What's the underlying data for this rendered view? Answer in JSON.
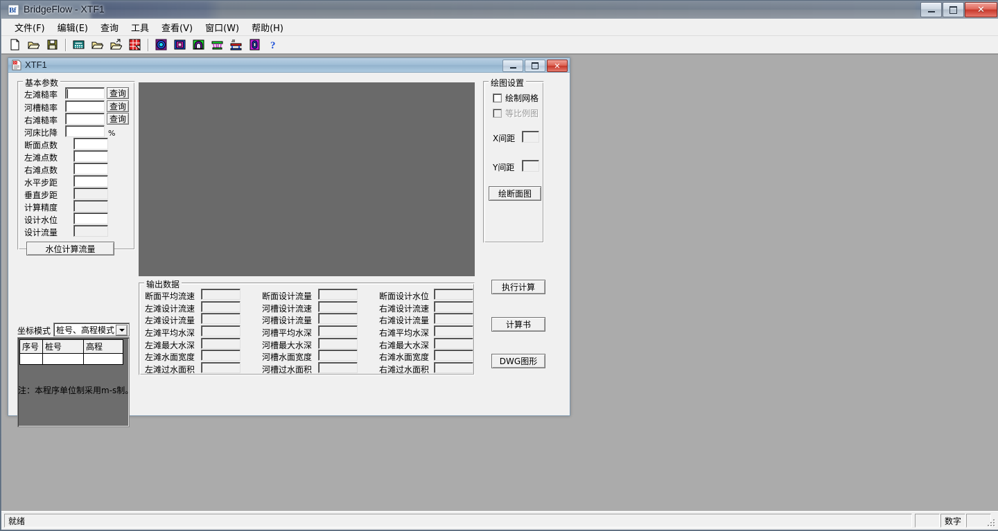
{
  "window": {
    "title": "BridgeFlow - XTF1",
    "icon": "app-icon",
    "minimize": "–",
    "maximize": "□",
    "close": "✕"
  },
  "menu": {
    "items": [
      {
        "label": "文件(F)",
        "name": "menu-file"
      },
      {
        "label": "编辑(E)",
        "name": "menu-edit"
      },
      {
        "label": "查询",
        "name": "menu-query"
      },
      {
        "label": "工具",
        "name": "menu-tools"
      },
      {
        "label": "查看(V)",
        "name": "menu-view"
      },
      {
        "label": "窗口(W)",
        "name": "menu-window"
      },
      {
        "label": "帮助(H)",
        "name": "menu-help"
      }
    ]
  },
  "toolbar": {
    "buttons": [
      {
        "name": "new-icon",
        "title": "新建"
      },
      {
        "name": "open-icon",
        "title": "打开"
      },
      {
        "name": "save-icon",
        "title": "保存"
      },
      {
        "name": "calculator-icon",
        "title": "计算"
      },
      {
        "name": "open-folder-icon",
        "title": "打开文件"
      },
      {
        "name": "open-folder-arrow-icon",
        "title": "导入"
      },
      {
        "name": "grid-red-icon",
        "title": "表格"
      },
      {
        "name": "circle-section-icon",
        "title": "圆形断面"
      },
      {
        "name": "square-section-icon",
        "title": "方形断面"
      },
      {
        "name": "arch-section-icon",
        "title": "拱形断面"
      },
      {
        "name": "pier-icon",
        "title": "桥墩"
      },
      {
        "name": "bridge-icon",
        "title": "桥梁"
      },
      {
        "name": "capsule-icon",
        "title": "构件"
      },
      {
        "name": "help-icon",
        "title": "帮助"
      }
    ]
  },
  "child_window": {
    "title": "XTF1",
    "icon": "document-icon",
    "minimize": "–",
    "maximize": "□",
    "close": "✕"
  },
  "basic_params": {
    "legend": "基本参数",
    "rows": [
      {
        "label": "左滩糙率",
        "value": "",
        "enabled": true,
        "focused": true,
        "query": "查询",
        "unit": ""
      },
      {
        "label": "河槽糙率",
        "value": "",
        "enabled": true,
        "focused": false,
        "query": "查询",
        "unit": ""
      },
      {
        "label": "右滩糙率",
        "value": "",
        "enabled": true,
        "focused": false,
        "query": "查询",
        "unit": ""
      },
      {
        "label": "河床比降",
        "value": "",
        "enabled": true,
        "focused": false,
        "query": "",
        "unit": "%"
      },
      {
        "label": "断面点数",
        "value": "",
        "enabled": true,
        "focused": false,
        "query": "",
        "unit": ""
      },
      {
        "label": "左滩点数",
        "value": "",
        "enabled": true,
        "focused": false,
        "query": "",
        "unit": ""
      },
      {
        "label": "右滩点数",
        "value": "",
        "enabled": true,
        "focused": false,
        "query": "",
        "unit": ""
      },
      {
        "label": "水平步距",
        "value": "",
        "enabled": true,
        "focused": false,
        "query": "",
        "unit": ""
      },
      {
        "label": "垂直步距",
        "value": "",
        "enabled": false,
        "focused": false,
        "query": "",
        "unit": ""
      },
      {
        "label": "计算精度",
        "value": "",
        "enabled": false,
        "focused": false,
        "query": "",
        "unit": ""
      },
      {
        "label": "设计水位",
        "value": "",
        "enabled": true,
        "focused": false,
        "query": "",
        "unit": ""
      },
      {
        "label": "设计流量",
        "value": "",
        "enabled": false,
        "focused": false,
        "query": "",
        "unit": ""
      }
    ],
    "calc_button": "水位计算流量"
  },
  "coord_mode": {
    "label": "坐标模式",
    "selected": "桩号、高程模式",
    "options": [
      "桩号、高程模式"
    ]
  },
  "point_table": {
    "columns": [
      "序号",
      "桩号",
      "高程"
    ],
    "rows": [
      [
        "",
        "",
        ""
      ]
    ]
  },
  "note": "注：本程序单位制采用m-s制。",
  "draw_settings": {
    "legend": "绘图设置",
    "grid_checkbox": {
      "label": "绘制网格",
      "checked": false,
      "enabled": true
    },
    "scale_checkbox": {
      "label": "等比例图",
      "checked": false,
      "enabled": false
    },
    "x_spacing": {
      "label": "X间距",
      "value": ""
    },
    "y_spacing": {
      "label": "Y间距",
      "value": ""
    },
    "draw_button": "绘断面图"
  },
  "output": {
    "legend": "输出数据",
    "columns": [
      {
        "fields": [
          {
            "label": "断面平均流速",
            "value": ""
          },
          {
            "label": "左滩设计流速",
            "value": ""
          },
          {
            "label": "左滩设计流量",
            "value": ""
          },
          {
            "label": "左滩平均水深",
            "value": ""
          },
          {
            "label": "左滩最大水深",
            "value": ""
          },
          {
            "label": "左滩水面宽度",
            "value": ""
          },
          {
            "label": "左滩过水面积",
            "value": ""
          }
        ]
      },
      {
        "fields": [
          {
            "label": "断面设计流量",
            "value": ""
          },
          {
            "label": "河槽设计流速",
            "value": ""
          },
          {
            "label": "河槽设计流量",
            "value": ""
          },
          {
            "label": "河槽平均水深",
            "value": ""
          },
          {
            "label": "河槽最大水深",
            "value": ""
          },
          {
            "label": "河槽水面宽度",
            "value": ""
          },
          {
            "label": "河槽过水面积",
            "value": ""
          }
        ]
      },
      {
        "fields": [
          {
            "label": "断面设计水位",
            "value": ""
          },
          {
            "label": "右滩设计流速",
            "value": ""
          },
          {
            "label": "右滩设计流量",
            "value": ""
          },
          {
            "label": "右滩平均水深",
            "value": ""
          },
          {
            "label": "右滩最大水深",
            "value": ""
          },
          {
            "label": "右滩水面宽度",
            "value": ""
          },
          {
            "label": "右滩过水面积",
            "value": ""
          }
        ]
      }
    ]
  },
  "actions": {
    "run": "执行计算",
    "report": "计算书",
    "dwg": "DWG图形"
  },
  "statusbar": {
    "message": "就绪",
    "pane_caps": "",
    "pane_num": "数字",
    "pane_scrl": ""
  },
  "colors": {
    "accent": "#3b6ea5",
    "canvas": "#6a6a6a",
    "mdi": "#ababab",
    "dialog": "#f0f0f0"
  }
}
